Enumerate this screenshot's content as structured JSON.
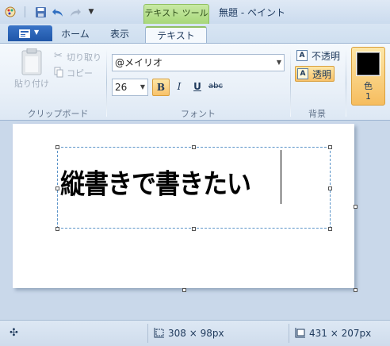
{
  "titlebar": {
    "context_tab": "テキスト ツール",
    "title": "無題 - ペイント"
  },
  "tabs": {
    "home": "ホーム",
    "view": "表示",
    "text": "テキスト"
  },
  "clipboard": {
    "paste": "貼り付け",
    "cut": "切り取り",
    "copy": "コピー",
    "group_label": "クリップボード"
  },
  "font": {
    "family": "@メイリオ",
    "size": "26",
    "bold": "B",
    "italic": "I",
    "underline": "U",
    "strikethrough": "abc",
    "group_label": "フォント"
  },
  "background": {
    "opaque": "不透明",
    "transparent": "透明",
    "group_label": "背景"
  },
  "color": {
    "label": "色",
    "number": "1",
    "value": "#000000"
  },
  "canvas": {
    "text": "縦書きで書きたい"
  },
  "statusbar": {
    "selection_size": "308 × 98px",
    "canvas_size": "431 × 207px"
  },
  "colors": {
    "accent_green": "#a7d77a",
    "file_blue": "#2a63b8",
    "active_orange": "#f8c26a"
  }
}
